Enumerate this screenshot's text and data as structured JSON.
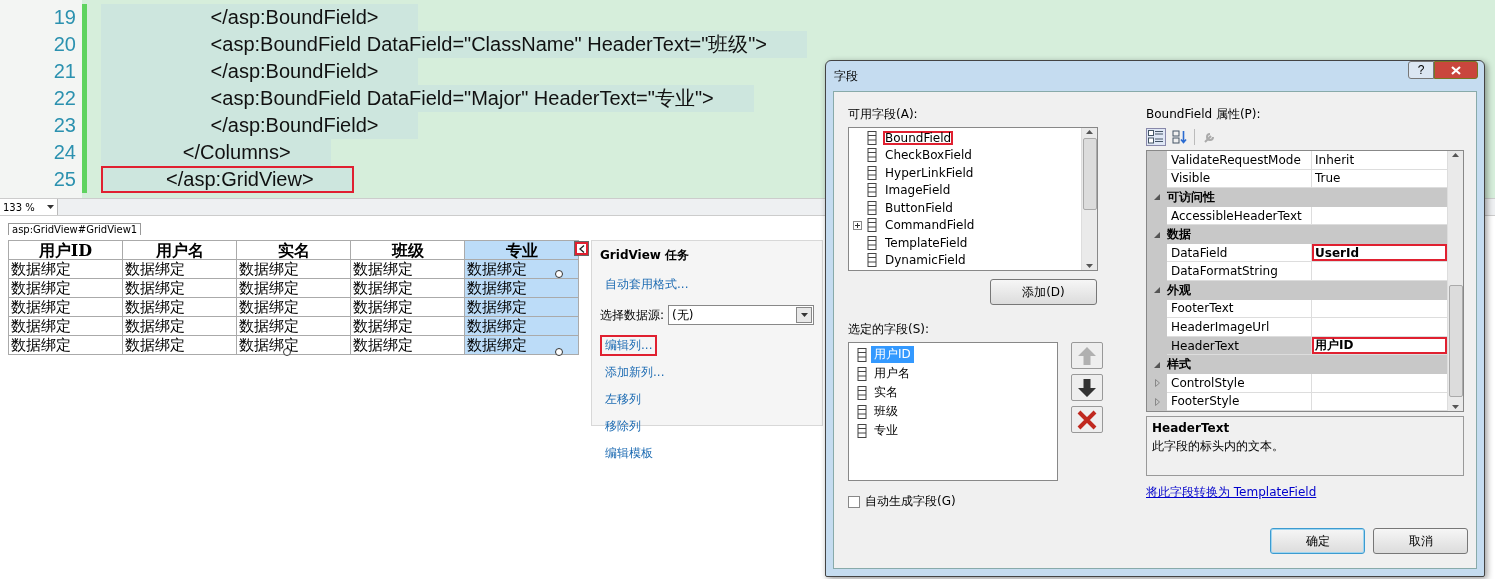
{
  "editor": {
    "lines": [
      {
        "number": "19",
        "text": "                   </asp:BoundField>",
        "annotated": false
      },
      {
        "number": "20",
        "text": "                   <asp:BoundField DataField=\"ClassName\" HeaderText=\"班级\">",
        "annotated": false
      },
      {
        "number": "21",
        "text": "                   </asp:BoundField>",
        "annotated": false
      },
      {
        "number": "22",
        "text": "                   <asp:BoundField DataField=\"Major\" HeaderText=\"专业\">",
        "annotated": false
      },
      {
        "number": "23",
        "text": "                   </asp:BoundField>",
        "annotated": false
      },
      {
        "number": "24",
        "text": "              </Columns>",
        "annotated": false
      },
      {
        "number": "25",
        "text": "           </asp:GridView>",
        "annotated": true
      }
    ],
    "zoom": "133 %"
  },
  "designer": {
    "tag": "asp:GridView#GridView1",
    "grid": {
      "columns": [
        {
          "header": "用户ID",
          "selected": false
        },
        {
          "header": "用户名",
          "selected": false
        },
        {
          "header": "实名",
          "selected": false
        },
        {
          "header": "班级",
          "selected": false
        },
        {
          "header": "专业",
          "selected": true
        }
      ],
      "rows": [
        [
          "数据绑定",
          "数据绑定",
          "数据绑定",
          "数据绑定",
          "数据绑定"
        ],
        [
          "数据绑定",
          "数据绑定",
          "数据绑定",
          "数据绑定",
          "数据绑定"
        ],
        [
          "数据绑定",
          "数据绑定",
          "数据绑定",
          "数据绑定",
          "数据绑定"
        ],
        [
          "数据绑定",
          "数据绑定",
          "数据绑定",
          "数据绑定",
          "数据绑定"
        ],
        [
          "数据绑定",
          "数据绑定",
          "数据绑定",
          "数据绑定",
          "数据绑定"
        ]
      ]
    },
    "smart_tag": {
      "annotated": true
    },
    "tasks": {
      "title": "GridView 任务",
      "items": [
        {
          "kind": "link",
          "label": "自动套用格式...",
          "annotated": false
        },
        {
          "kind": "select",
          "label": "选择数据源:",
          "value": "(无)"
        },
        {
          "kind": "link",
          "label": "编辑列...",
          "annotated": true
        },
        {
          "kind": "link",
          "label": "添加新列...",
          "annotated": false
        },
        {
          "kind": "link",
          "label": "左移列",
          "annotated": false
        },
        {
          "kind": "link",
          "label": "移除列",
          "annotated": false
        },
        {
          "kind": "link",
          "label": "编辑模板",
          "annotated": false
        }
      ]
    }
  },
  "dialog": {
    "title": "字段",
    "help": "?",
    "available": {
      "label": "可用字段(A):",
      "items": [
        {
          "label": "BoundField",
          "has_children": false,
          "annotated": true
        },
        {
          "label": "CheckBoxField",
          "has_children": false,
          "annotated": false
        },
        {
          "label": "HyperLinkField",
          "has_children": false,
          "annotated": false
        },
        {
          "label": "ImageField",
          "has_children": false,
          "annotated": false
        },
        {
          "label": "ButtonField",
          "has_children": false,
          "annotated": false
        },
        {
          "label": "CommandField",
          "has_children": true,
          "annotated": false
        },
        {
          "label": "TemplateField",
          "has_children": false,
          "annotated": false
        },
        {
          "label": "DynamicField",
          "has_children": false,
          "annotated": false
        }
      ],
      "add_button": "添加(D)"
    },
    "selected_fields": {
      "label": "选定的字段(S):",
      "items": [
        {
          "label": "用户ID",
          "selected": true
        },
        {
          "label": "用户名",
          "selected": false
        },
        {
          "label": "实名",
          "selected": false
        },
        {
          "label": "班级",
          "selected": false
        },
        {
          "label": "专业",
          "selected": false
        }
      ]
    },
    "auto_generate": {
      "label": "自动生成字段(G)",
      "checked": false
    },
    "properties": {
      "label": "BoundField 属性(P):",
      "rows": [
        {
          "kind": "property",
          "name": "ValidateRequestMode",
          "value": "Inherit",
          "bold": false,
          "selected": false,
          "annotated": false,
          "expandable": false
        },
        {
          "kind": "property",
          "name": "Visible",
          "value": "True",
          "bold": false,
          "selected": false,
          "annotated": false,
          "expandable": false
        },
        {
          "kind": "category",
          "name": "可访问性"
        },
        {
          "kind": "property",
          "name": "AccessibleHeaderText",
          "selected": false,
          "expandable": false
        },
        {
          "kind": "category",
          "name": "数据"
        },
        {
          "kind": "property",
          "name": "DataField",
          "value": "UserId",
          "bold": true,
          "selected": false,
          "annotated": true,
          "expandable": false
        },
        {
          "kind": "property",
          "name": "DataFormatString",
          "selected": false,
          "expandable": false
        },
        {
          "kind": "category",
          "name": "外观"
        },
        {
          "kind": "property",
          "name": "FooterText",
          "selected": false,
          "expandable": false
        },
        {
          "kind": "property",
          "name": "HeaderImageUrl",
          "selected": false,
          "expandable": false
        },
        {
          "kind": "property",
          "name": "HeaderText",
          "value": "用户ID",
          "bold": true,
          "selected": true,
          "annotated": true,
          "expandable": false
        },
        {
          "kind": "category",
          "name": "样式"
        },
        {
          "kind": "property",
          "name": "ControlStyle",
          "selected": false,
          "expandable": true
        },
        {
          "kind": "property",
          "name": "FooterStyle",
          "selected": false,
          "expandable": true
        }
      ]
    },
    "description": {
      "title": "HeaderText",
      "text": "此字段的标头内的文本。"
    },
    "convert_link": "将此字段转换为 TemplateField",
    "buttons": [
      {
        "label": "确定",
        "default": true
      },
      {
        "label": "取消",
        "default": false
      }
    ]
  }
}
